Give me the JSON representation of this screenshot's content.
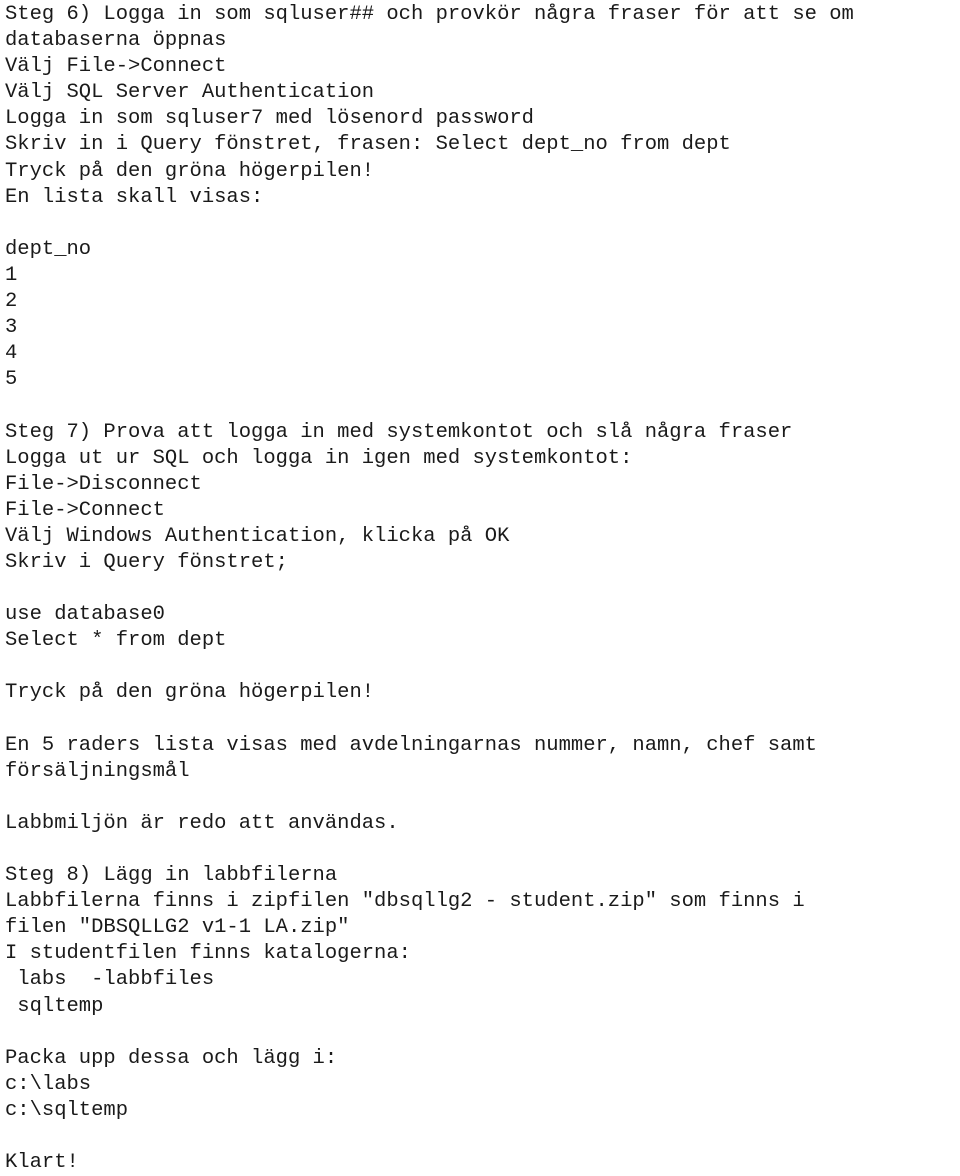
{
  "document": {
    "language": "sv",
    "background_color": "#ffffff",
    "text_color": "#1a1a1a",
    "lines": [
      "Steg 6) Logga in som sqluser## och provkör några fraser för att se om",
      "databaserna öppnas",
      "Välj File->Connect",
      "Välj SQL Server Authentication",
      "Logga in som sqluser7 med lösenord password",
      "Skriv in i Query fönstret, frasen: Select dept_no from dept",
      "Tryck på den gröna högerpilen!",
      "En lista skall visas:",
      "",
      "dept_no",
      "1",
      "2",
      "3",
      "4",
      "5",
      "",
      "Steg 7) Prova att logga in med systemkontot och slå några fraser",
      "Logga ut ur SQL och logga in igen med systemkontot:",
      "File->Disconnect",
      "File->Connect",
      "Välj Windows Authentication, klicka på OK",
      "Skriv i Query fönstret;",
      "",
      "use database0",
      "Select * from dept",
      "",
      "Tryck på den gröna högerpilen!",
      "",
      "En 5 raders lista visas med avdelningarnas nummer, namn, chef samt",
      "försäljningsmål",
      "",
      "Labbmiljön är redo att användas.",
      "",
      "Steg 8) Lägg in labbfilerna",
      "Labbfilerna finns i zipfilen \"dbsqllg2 - student.zip\" som finns i",
      "filen \"DBSQLLG2 v1-1 LA.zip\"",
      "I studentfilen finns katalogerna:",
      " labs  -labbfiles",
      " sqltemp",
      "",
      "Packa upp dessa och lägg i:",
      "c:\\labs",
      "c:\\sqltemp",
      "",
      "Klart!"
    ]
  }
}
